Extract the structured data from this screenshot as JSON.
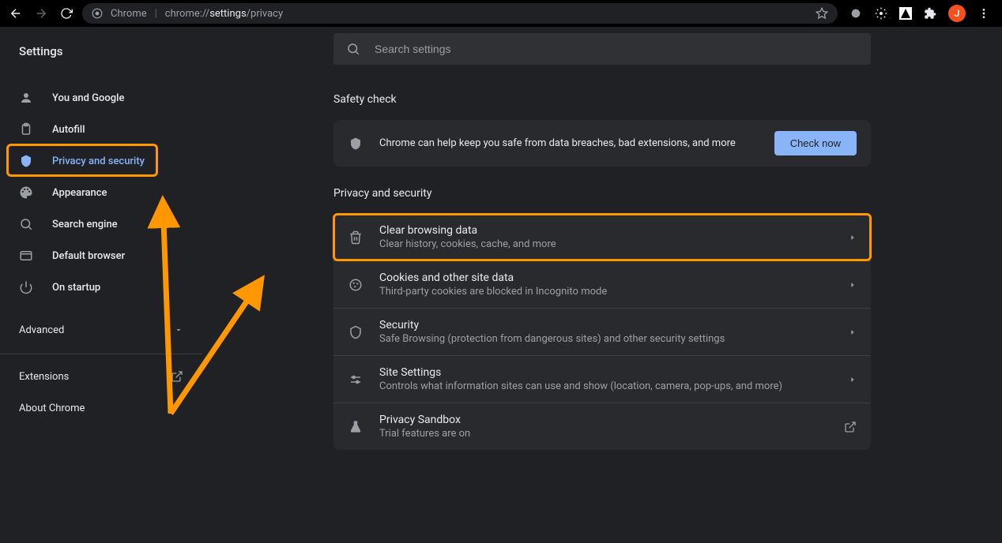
{
  "browser": {
    "site_label": "Chrome",
    "url_prefix": "chrome://",
    "url_bold": "settings",
    "url_suffix": "/privacy",
    "avatar_letter": "J"
  },
  "sidebar": {
    "title": "Settings",
    "items": [
      {
        "label": "You and Google"
      },
      {
        "label": "Autofill"
      },
      {
        "label": "Privacy and security",
        "selected": true
      },
      {
        "label": "Appearance"
      },
      {
        "label": "Search engine"
      },
      {
        "label": "Default browser"
      },
      {
        "label": "On startup"
      }
    ],
    "advanced": "Advanced",
    "extensions": "Extensions",
    "about": "About Chrome"
  },
  "search": {
    "placeholder": "Search settings"
  },
  "safety": {
    "heading": "Safety check",
    "text": "Chrome can help keep you safe from data breaches, bad extensions, and more",
    "button": "Check now"
  },
  "privacy": {
    "heading": "Privacy and security",
    "rows": [
      {
        "title": "Clear browsing data",
        "sub": "Clear history, cookies, cache, and more",
        "highlight": true
      },
      {
        "title": "Cookies and other site data",
        "sub": "Third-party cookies are blocked in Incognito mode"
      },
      {
        "title": "Security",
        "sub": "Safe Browsing (protection from dangerous sites) and other security settings"
      },
      {
        "title": "Site Settings",
        "sub": "Controls what information sites can use and show (location, camera, pop-ups, and more)"
      },
      {
        "title": "Privacy Sandbox",
        "sub": "Trial features are on",
        "external": true
      }
    ]
  },
  "annotations": {
    "highlight_nav_index": 2,
    "highlight_row_index": 0
  }
}
